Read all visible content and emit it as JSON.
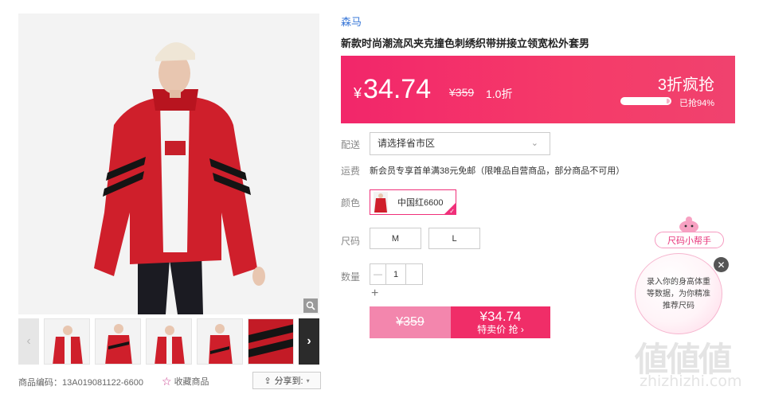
{
  "gallery": {
    "thumbnails_count": 5,
    "sku_label": "商品编码：13A019081122-6600",
    "favorite_label": "收藏商品",
    "share_label": "分享到:"
  },
  "product": {
    "brand": "森马",
    "title": "新款时尚潮流风夹克撞色刺绣织带拼接立领宽松外套男"
  },
  "promo": {
    "currency": "¥",
    "price_now": "34.74",
    "price_original": "¥359",
    "discount": "1.0折",
    "flash_title": "3折疯抢",
    "sold_text": "已抢94%",
    "sold_fraction": 0.94,
    "colors": {
      "accent": "#f2266a",
      "brand_blue": "#3a78d8"
    }
  },
  "options": {
    "delivery_label": "配送",
    "region_placeholder": "请选择省市区",
    "shipping_label": "运费",
    "shipping_text": "新会员专享首单满38元免邮（限唯品自营商品，部分商品不可用）",
    "color_label": "颜色",
    "color_value": "中国红6600",
    "size_label": "尺码",
    "sizes": [
      "M",
      "L"
    ],
    "qty_label": "数量",
    "qty_minus": "—",
    "qty_value": "1",
    "qty_plus": "+"
  },
  "buy": {
    "normal_price": "¥359",
    "flash_price": "¥34.74",
    "flash_label": "特卖价 抢"
  },
  "helper": {
    "tag": "尺码小帮手",
    "text": "录入你的身高体重等数据，为你精准推荐尺码"
  },
  "watermark": {
    "logo": "値値値",
    "url": "zhizhizhi.com"
  }
}
